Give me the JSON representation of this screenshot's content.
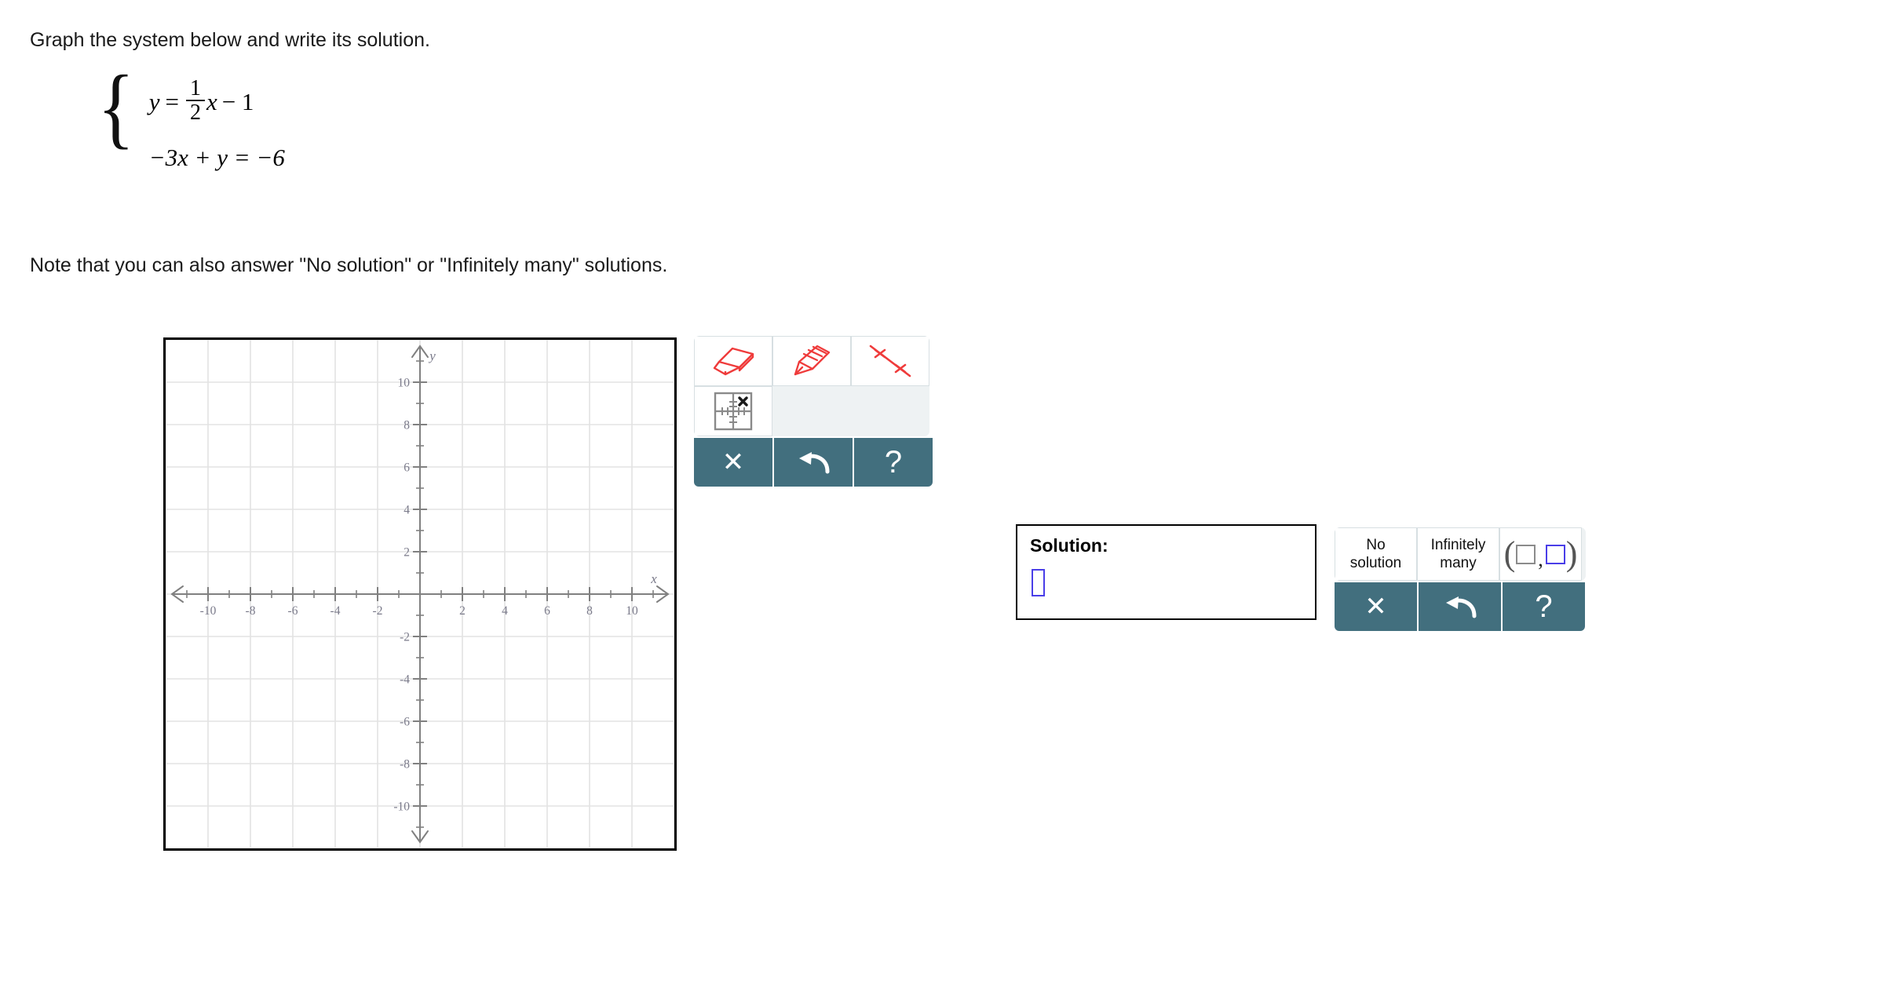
{
  "prompt": {
    "instruction": "Graph the system below and write its solution.",
    "note": "Note that you can also answer \"No solution\" or \"Infinitely many\" solutions."
  },
  "system": {
    "equation1": {
      "lhs": "y",
      "equals": "=",
      "fraction_numerator": "1",
      "fraction_denominator": "2",
      "variable": "x",
      "constant": "− 1",
      "full_text": "y = (1/2)x − 1"
    },
    "equation2": {
      "full_text": "−3x + y = −6"
    }
  },
  "graph": {
    "x_axis_label": "x",
    "y_axis_label": "y",
    "x_tick_labels": [
      "-10",
      "-8",
      "-6",
      "-4",
      "-2",
      "2",
      "4",
      "6",
      "8",
      "10"
    ],
    "y_tick_labels": [
      "10",
      "8",
      "6",
      "4",
      "2",
      "-2",
      "-4",
      "-6",
      "-8",
      "-10"
    ],
    "x_min": -12,
    "x_max": 12,
    "y_min": -12,
    "y_max": 12,
    "major_tick_step": 2,
    "minor_tick_step": 1,
    "grid_step": 2,
    "grid_color": "#e3e3e3",
    "axis_color": "#808080",
    "label_color": "#7a7a8a",
    "border_color": "#000000",
    "plotted_lines": []
  },
  "draw_toolbar": {
    "tools": [
      {
        "name": "eraser",
        "label": "Eraser",
        "selected": false
      },
      {
        "name": "pencil",
        "label": "Draw",
        "selected": false
      },
      {
        "name": "line-through-points",
        "label": "Line",
        "selected": false
      },
      {
        "name": "plot-point",
        "label": "Plot point",
        "selected": false
      }
    ],
    "actions": [
      {
        "name": "clear",
        "glyph": "✕",
        "label": "Clear all"
      },
      {
        "name": "undo",
        "glyph": "undo-arrow",
        "label": "Undo"
      },
      {
        "name": "help",
        "glyph": "?",
        "label": "Help"
      }
    ],
    "accent_color": "#426f7e",
    "tool_icon_color": "#ef3b3b",
    "panel_bg": "#eef2f3"
  },
  "solution": {
    "label": "Solution:",
    "input_value": "",
    "input_placeholder": "",
    "border_color": "#4a3ee8"
  },
  "answer_toolbar": {
    "options": [
      {
        "name": "no-solution",
        "line1": "No",
        "line2": "solution"
      },
      {
        "name": "infinitely-many",
        "line1": "Infinitely",
        "line2": "many"
      },
      {
        "name": "ordered-pair",
        "template": "(□,□)",
        "active_box_index": 1
      }
    ],
    "actions": [
      {
        "name": "clear",
        "glyph": "✕",
        "label": "Clear"
      },
      {
        "name": "undo",
        "glyph": "undo-arrow",
        "label": "Undo"
      },
      {
        "name": "help",
        "glyph": "?",
        "label": "Help"
      }
    ],
    "accent_color": "#426f7e"
  }
}
